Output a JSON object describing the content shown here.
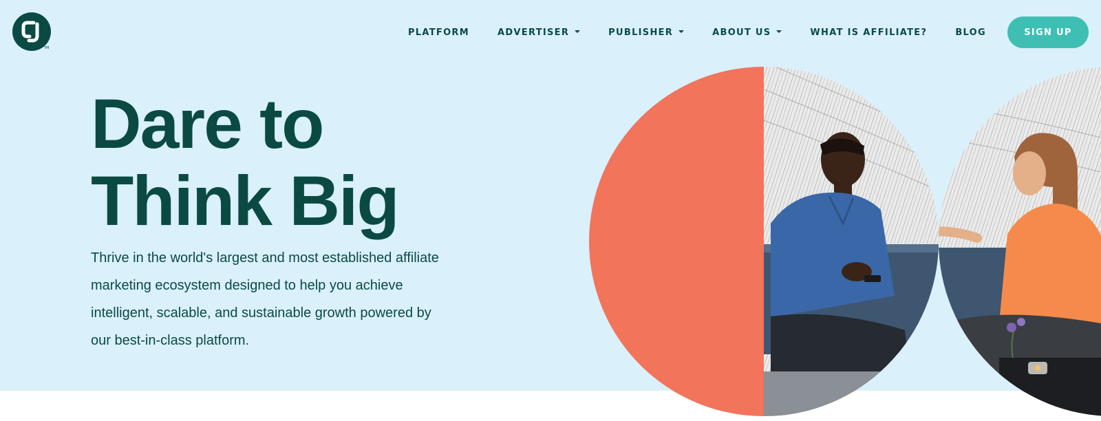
{
  "header": {
    "logo_text": "CJ",
    "trademark": "TM",
    "nav": [
      {
        "label": "PLATFORM",
        "has_dropdown": false
      },
      {
        "label": "ADVERTISER",
        "has_dropdown": true
      },
      {
        "label": "PUBLISHER",
        "has_dropdown": true
      },
      {
        "label": "ABOUT US",
        "has_dropdown": true
      },
      {
        "label": "WHAT IS AFFILIATE?",
        "has_dropdown": false
      },
      {
        "label": "BLOG",
        "has_dropdown": false
      }
    ],
    "signup_label": "SIGN UP"
  },
  "hero": {
    "headline_line1": "Dare to",
    "headline_line2": "Think Big",
    "subtext": "Thrive in the world's largest and most established affiliate marketing ecosystem designed to help you achieve intelligent, scalable, and sustainable growth powered by our best-in-class platform."
  },
  "colors": {
    "hero_background": "#daf0fb",
    "brand_dark_green": "#0a4a43",
    "signup_teal": "#3fbfb3",
    "coral_accent": "#f2745b"
  },
  "icons": {
    "logo": "cj-logo-icon",
    "dropdown": "caret-down-icon"
  }
}
